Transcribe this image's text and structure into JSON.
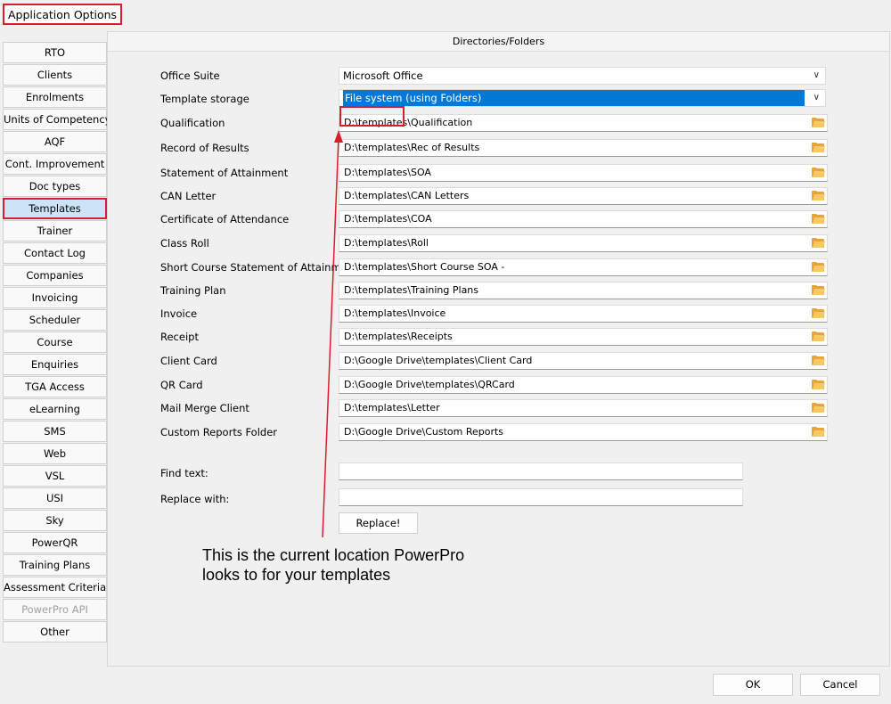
{
  "window": {
    "title": "Application Options"
  },
  "sidebar": {
    "items": [
      {
        "label": "RTO"
      },
      {
        "label": "Clients"
      },
      {
        "label": "Enrolments"
      },
      {
        "label": "Units of Competency"
      },
      {
        "label": "AQF"
      },
      {
        "label": "Cont. Improvement"
      },
      {
        "label": "Doc types"
      },
      {
        "label": "Templates",
        "selected": true
      },
      {
        "label": "Trainer"
      },
      {
        "label": "Contact Log"
      },
      {
        "label": "Companies"
      },
      {
        "label": "Invoicing"
      },
      {
        "label": "Scheduler"
      },
      {
        "label": "Course"
      },
      {
        "label": "Enquiries"
      },
      {
        "label": "TGA Access"
      },
      {
        "label": "eLearning"
      },
      {
        "label": "SMS"
      },
      {
        "label": "Web"
      },
      {
        "label": "VSL"
      },
      {
        "label": "USI"
      },
      {
        "label": "Sky"
      },
      {
        "label": "PowerQR"
      },
      {
        "label": "Training Plans"
      },
      {
        "label": "Assessment Criteria"
      },
      {
        "label": "PowerPro API",
        "disabled": true
      },
      {
        "label": "Other"
      }
    ]
  },
  "panel": {
    "header": "Directories/Folders",
    "office_suite": {
      "label": "Office Suite",
      "value": "Microsoft Office"
    },
    "template_storage": {
      "label": "Template storage",
      "value": "File system (using Folders)"
    },
    "folders": [
      {
        "label": "Qualification",
        "value": "D:\\templates\\Qualification"
      },
      {
        "label": "Record of Results",
        "value": "D:\\templates\\Rec of Results"
      },
      {
        "label": "Statement of Attainment",
        "value": "D:\\templates\\SOA"
      },
      {
        "label": "CAN Letter",
        "value": "D:\\templates\\CAN Letters"
      },
      {
        "label": "Certificate of Attendance",
        "value": "D:\\templates\\COA"
      },
      {
        "label": "Class Roll",
        "value": "D:\\templates\\Roll"
      },
      {
        "label": "Short Course Statement of Attainment",
        "value": "D:\\templates\\Short Course SOA -"
      },
      {
        "label": "Training Plan",
        "value": "D:\\templates\\Training Plans"
      },
      {
        "label": "Invoice",
        "value": "D:\\templates\\Invoice"
      },
      {
        "label": "Receipt",
        "value": "D:\\templates\\Receipts"
      },
      {
        "label": "Client Card",
        "value": "D:\\Google Drive\\templates\\Client Card"
      },
      {
        "label": "QR Card",
        "value": "D:\\Google Drive\\templates\\QRCard"
      },
      {
        "label": "Mail Merge Client",
        "value": "D:\\templates\\Letter"
      },
      {
        "label": "Custom Reports Folder",
        "value": "D:\\Google Drive\\Custom Reports"
      }
    ],
    "find_text": {
      "label": "Find text:",
      "value": ""
    },
    "replace_with": {
      "label": "Replace with:",
      "value": ""
    },
    "replace_button": "Replace!"
  },
  "annotation": {
    "text": "This is the current location PowerPro\nlooks to for your templates",
    "color": "#d81e2a"
  },
  "footer": {
    "ok": "OK",
    "cancel": "Cancel"
  }
}
